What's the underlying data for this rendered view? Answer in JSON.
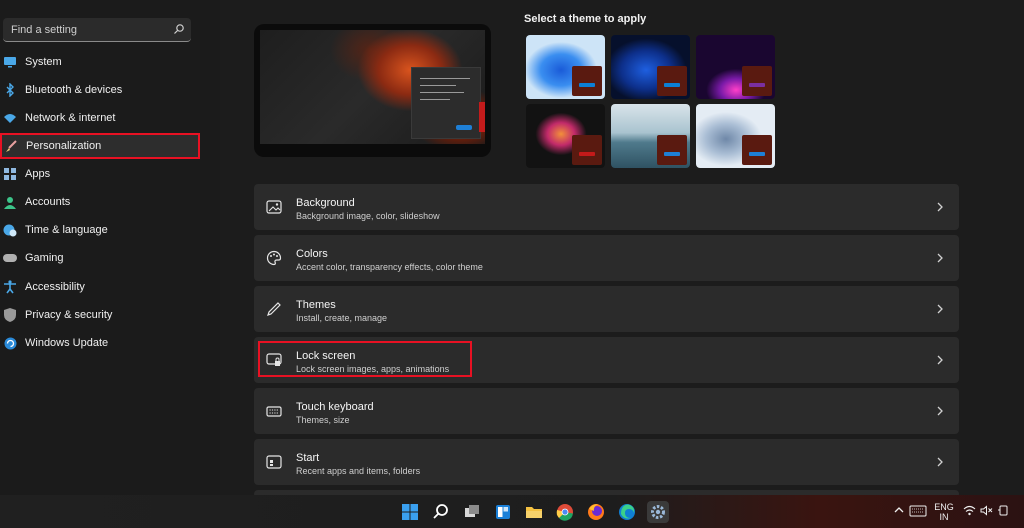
{
  "search": {
    "placeholder": "Find a setting",
    "icon": "search-icon"
  },
  "sidebar": {
    "items": [
      {
        "label": "System",
        "icon": "monitor-icon",
        "selected": false
      },
      {
        "label": "Bluetooth & devices",
        "icon": "bluetooth-icon",
        "selected": false
      },
      {
        "label": "Network & internet",
        "icon": "wifi-icon",
        "selected": false
      },
      {
        "label": "Personalization",
        "icon": "brush-icon",
        "selected": true
      },
      {
        "label": "Apps",
        "icon": "apps-icon",
        "selected": false
      },
      {
        "label": "Accounts",
        "icon": "person-icon",
        "selected": false
      },
      {
        "label": "Time & language",
        "icon": "globe-clock-icon",
        "selected": false
      },
      {
        "label": "Gaming",
        "icon": "gamepad-icon",
        "selected": false
      },
      {
        "label": "Accessibility",
        "icon": "accessibility-icon",
        "selected": false
      },
      {
        "label": "Privacy & security",
        "icon": "shield-icon",
        "selected": false
      },
      {
        "label": "Windows Update",
        "icon": "update-icon",
        "selected": false
      }
    ]
  },
  "themes": {
    "title": "Select a theme to apply",
    "items": [
      {
        "name": "windows-light-bloom",
        "accent": "#0b7fd6"
      },
      {
        "name": "windows-dark-bloom",
        "accent": "#0b7fd6"
      },
      {
        "name": "glow",
        "accent": "#7a2fa0"
      },
      {
        "name": "captured-motion",
        "accent": "#c41a1a"
      },
      {
        "name": "sunrise",
        "accent": "#1e7fd6"
      },
      {
        "name": "flow",
        "accent": "#1e7fd6"
      }
    ]
  },
  "cards": [
    {
      "title": "Background",
      "subtitle": "Background image, color, slideshow",
      "icon": "image-icon",
      "highlighted": false
    },
    {
      "title": "Colors",
      "subtitle": "Accent color, transparency effects, color theme",
      "icon": "palette-icon",
      "highlighted": false
    },
    {
      "title": "Themes",
      "subtitle": "Install, create, manage",
      "icon": "pen-icon",
      "highlighted": false
    },
    {
      "title": "Lock screen",
      "subtitle": "Lock screen images, apps, animations",
      "icon": "lock-screen-icon",
      "highlighted": true
    },
    {
      "title": "Touch keyboard",
      "subtitle": "Themes, size",
      "icon": "keyboard-icon",
      "highlighted": false
    },
    {
      "title": "Start",
      "subtitle": "Recent apps and items, folders",
      "icon": "start-icon",
      "highlighted": false
    }
  ],
  "taskbar": {
    "apps": [
      "windows-start-icon",
      "search-icon",
      "task-view-icon",
      "widgets-icon",
      "file-explorer-icon",
      "chrome-icon",
      "firefox-icon",
      "edge-icon",
      "settings-icon"
    ],
    "tray": {
      "language": "ENG",
      "region": "IN"
    }
  },
  "colors": {
    "highlight": "#e81123",
    "accent": "#0b7fd6"
  }
}
